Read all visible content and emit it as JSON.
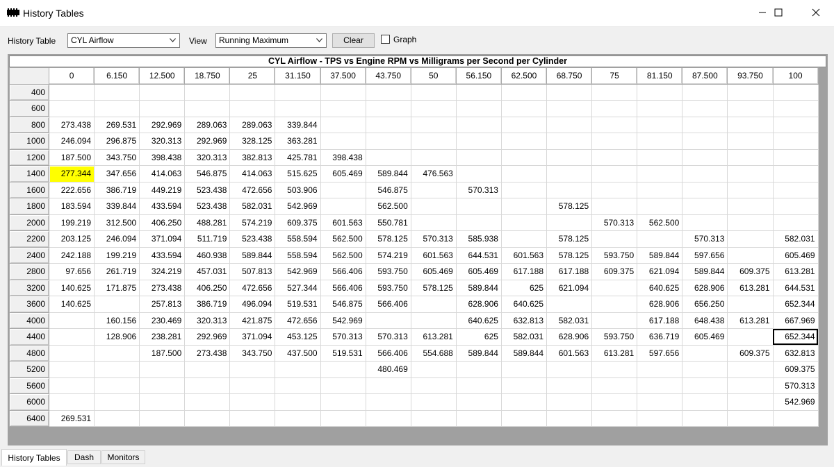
{
  "window": {
    "title": "History Tables"
  },
  "toolbar": {
    "history_table_label": "History Table",
    "history_table_value": "CYL Airflow",
    "view_label": "View",
    "view_value": "Running Maximum",
    "clear_label": "Clear",
    "graph_label": "Graph",
    "graph_checked": false
  },
  "grid": {
    "title": "CYL Airflow - TPS vs Engine RPM vs Milligrams per Second per Cylinder",
    "columns": [
      "0",
      "6.150",
      "12.500",
      "18.750",
      "25",
      "31.150",
      "37.500",
      "43.750",
      "50",
      "56.150",
      "62.500",
      "68.750",
      "75",
      "81.150",
      "87.500",
      "93.750",
      "100"
    ],
    "rows": [
      {
        "rpm": "400",
        "cells": [
          "",
          "",
          "",
          "",
          "",
          "",
          "",
          "",
          "",
          "",
          "",
          "",
          "",
          "",
          "",
          "",
          ""
        ]
      },
      {
        "rpm": "600",
        "cells": [
          "",
          "",
          "",
          "",
          "",
          "",
          "",
          "",
          "",
          "",
          "",
          "",
          "",
          "",
          "",
          "",
          ""
        ]
      },
      {
        "rpm": "800",
        "cells": [
          "273.438",
          "269.531",
          "292.969",
          "289.063",
          "289.063",
          "339.844",
          "",
          "",
          "",
          "",
          "",
          "",
          "",
          "",
          "",
          "",
          ""
        ]
      },
      {
        "rpm": "1000",
        "cells": [
          "246.094",
          "296.875",
          "320.313",
          "292.969",
          "328.125",
          "363.281",
          "",
          "",
          "",
          "",
          "",
          "",
          "",
          "",
          "",
          "",
          ""
        ]
      },
      {
        "rpm": "1200",
        "cells": [
          "187.500",
          "343.750",
          "398.438",
          "320.313",
          "382.813",
          "425.781",
          "398.438",
          "",
          "",
          "",
          "",
          "",
          "",
          "",
          "",
          "",
          ""
        ]
      },
      {
        "rpm": "1400",
        "cells": [
          "277.344",
          "347.656",
          "414.063",
          "546.875",
          "414.063",
          "515.625",
          "605.469",
          "589.844",
          "476.563",
          "",
          "",
          "",
          "",
          "",
          "",
          "",
          ""
        ]
      },
      {
        "rpm": "1600",
        "cells": [
          "222.656",
          "386.719",
          "449.219",
          "523.438",
          "472.656",
          "503.906",
          "",
          "546.875",
          "",
          "570.313",
          "",
          "",
          "",
          "",
          "",
          "",
          ""
        ]
      },
      {
        "rpm": "1800",
        "cells": [
          "183.594",
          "339.844",
          "433.594",
          "523.438",
          "582.031",
          "542.969",
          "",
          "562.500",
          "",
          "",
          "",
          "578.125",
          "",
          "",
          "",
          "",
          ""
        ]
      },
      {
        "rpm": "2000",
        "cells": [
          "199.219",
          "312.500",
          "406.250",
          "488.281",
          "574.219",
          "609.375",
          "601.563",
          "550.781",
          "",
          "",
          "",
          "",
          "570.313",
          "562.500",
          "",
          "",
          ""
        ]
      },
      {
        "rpm": "2200",
        "cells": [
          "203.125",
          "246.094",
          "371.094",
          "511.719",
          "523.438",
          "558.594",
          "562.500",
          "578.125",
          "570.313",
          "585.938",
          "",
          "578.125",
          "",
          "",
          "570.313",
          "",
          "582.031"
        ]
      },
      {
        "rpm": "2400",
        "cells": [
          "242.188",
          "199.219",
          "433.594",
          "460.938",
          "589.844",
          "558.594",
          "562.500",
          "574.219",
          "601.563",
          "644.531",
          "601.563",
          "578.125",
          "593.750",
          "589.844",
          "597.656",
          "",
          "605.469"
        ]
      },
      {
        "rpm": "2800",
        "cells": [
          "97.656",
          "261.719",
          "324.219",
          "457.031",
          "507.813",
          "542.969",
          "566.406",
          "593.750",
          "605.469",
          "605.469",
          "617.188",
          "617.188",
          "609.375",
          "621.094",
          "589.844",
          "609.375",
          "613.281"
        ]
      },
      {
        "rpm": "3200",
        "cells": [
          "140.625",
          "171.875",
          "273.438",
          "406.250",
          "472.656",
          "527.344",
          "566.406",
          "593.750",
          "578.125",
          "589.844",
          "625",
          "621.094",
          "",
          "640.625",
          "628.906",
          "613.281",
          "644.531"
        ]
      },
      {
        "rpm": "3600",
        "cells": [
          "140.625",
          "",
          "257.813",
          "386.719",
          "496.094",
          "519.531",
          "546.875",
          "566.406",
          "",
          "628.906",
          "640.625",
          "",
          "",
          "628.906",
          "656.250",
          "",
          "652.344"
        ]
      },
      {
        "rpm": "4000",
        "cells": [
          "",
          "160.156",
          "230.469",
          "320.313",
          "421.875",
          "472.656",
          "542.969",
          "",
          "",
          "640.625",
          "632.813",
          "582.031",
          "",
          "617.188",
          "648.438",
          "613.281",
          "667.969"
        ]
      },
      {
        "rpm": "4400",
        "cells": [
          "",
          "128.906",
          "238.281",
          "292.969",
          "371.094",
          "453.125",
          "570.313",
          "570.313",
          "613.281",
          "625",
          "582.031",
          "628.906",
          "593.750",
          "636.719",
          "605.469",
          "",
          "652.344"
        ]
      },
      {
        "rpm": "4800",
        "cells": [
          "",
          "",
          "187.500",
          "273.438",
          "343.750",
          "437.500",
          "519.531",
          "566.406",
          "554.688",
          "589.844",
          "589.844",
          "601.563",
          "613.281",
          "597.656",
          "",
          "609.375",
          "632.813"
        ]
      },
      {
        "rpm": "5200",
        "cells": [
          "",
          "",
          "",
          "",
          "",
          "",
          "",
          "480.469",
          "",
          "",
          "",
          "",
          "",
          "",
          "",
          "",
          "609.375"
        ]
      },
      {
        "rpm": "5600",
        "cells": [
          "",
          "",
          "",
          "",
          "",
          "",
          "",
          "",
          "",
          "",
          "",
          "",
          "",
          "",
          "",
          "",
          "570.313"
        ]
      },
      {
        "rpm": "6000",
        "cells": [
          "",
          "",
          "",
          "",
          "",
          "",
          "",
          "",
          "",
          "",
          "",
          "",
          "",
          "",
          "",
          "",
          "542.969"
        ]
      },
      {
        "rpm": "6400",
        "cells": [
          "269.531",
          "",
          "",
          "",
          "",
          "",
          "",
          "",
          "",
          "",
          "",
          "",
          "",
          "",
          "",
          "",
          ""
        ]
      }
    ],
    "highlight_color": "#ffff00"
  },
  "tabs": [
    {
      "label": "History Tables",
      "active": true
    },
    {
      "label": "Dash",
      "active": false
    },
    {
      "label": "Monitors",
      "active": false
    }
  ]
}
